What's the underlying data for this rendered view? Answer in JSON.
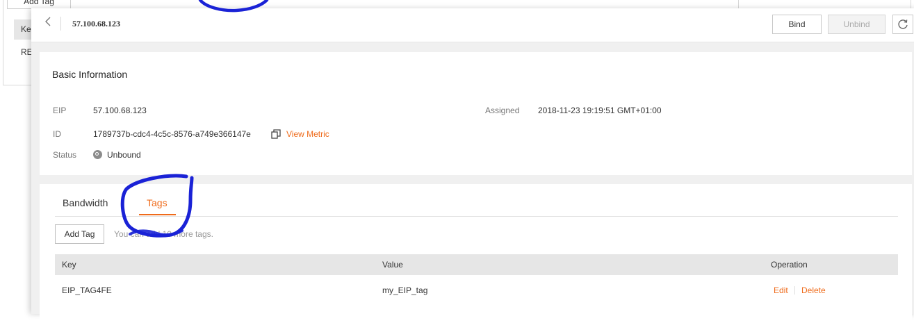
{
  "background": {
    "add_tag": "Add Tag",
    "key_header": "Ke",
    "row_text": "RE"
  },
  "header": {
    "back_icon": "chevron-left-icon",
    "title": "57.100.68.123",
    "bind_label": "Bind",
    "unbind_label": "Unbind",
    "refresh_icon": "refresh-icon"
  },
  "basic_info": {
    "section_title": "Basic Information",
    "eip_label": "EIP",
    "eip_value": "57.100.68.123",
    "id_label": "ID",
    "id_value": "1789737b-cdc4-4c5c-8576-a749e366147e",
    "copy_icon": "copy-icon",
    "view_metric": "View Metric",
    "status_label": "Status",
    "status_value": "Unbound",
    "assigned_label": "Assigned",
    "assigned_value": "2018-11-23 19:19:51 GMT+01:00"
  },
  "tabs": [
    {
      "label": "Bandwidth",
      "active": false
    },
    {
      "label": "Tags",
      "active": true
    }
  ],
  "tags": {
    "add_tag_label": "Add Tag",
    "hint": "You can add 10 more tags.",
    "columns": [
      "Key",
      "Value",
      "Operation"
    ],
    "rows": [
      {
        "key": "EIP_TAG4FE",
        "value": "my_EIP_tag",
        "edit": "Edit",
        "delete": "Delete"
      }
    ]
  },
  "colors": {
    "accent": "#ef6b1b",
    "annotation": "#1a22d6"
  }
}
